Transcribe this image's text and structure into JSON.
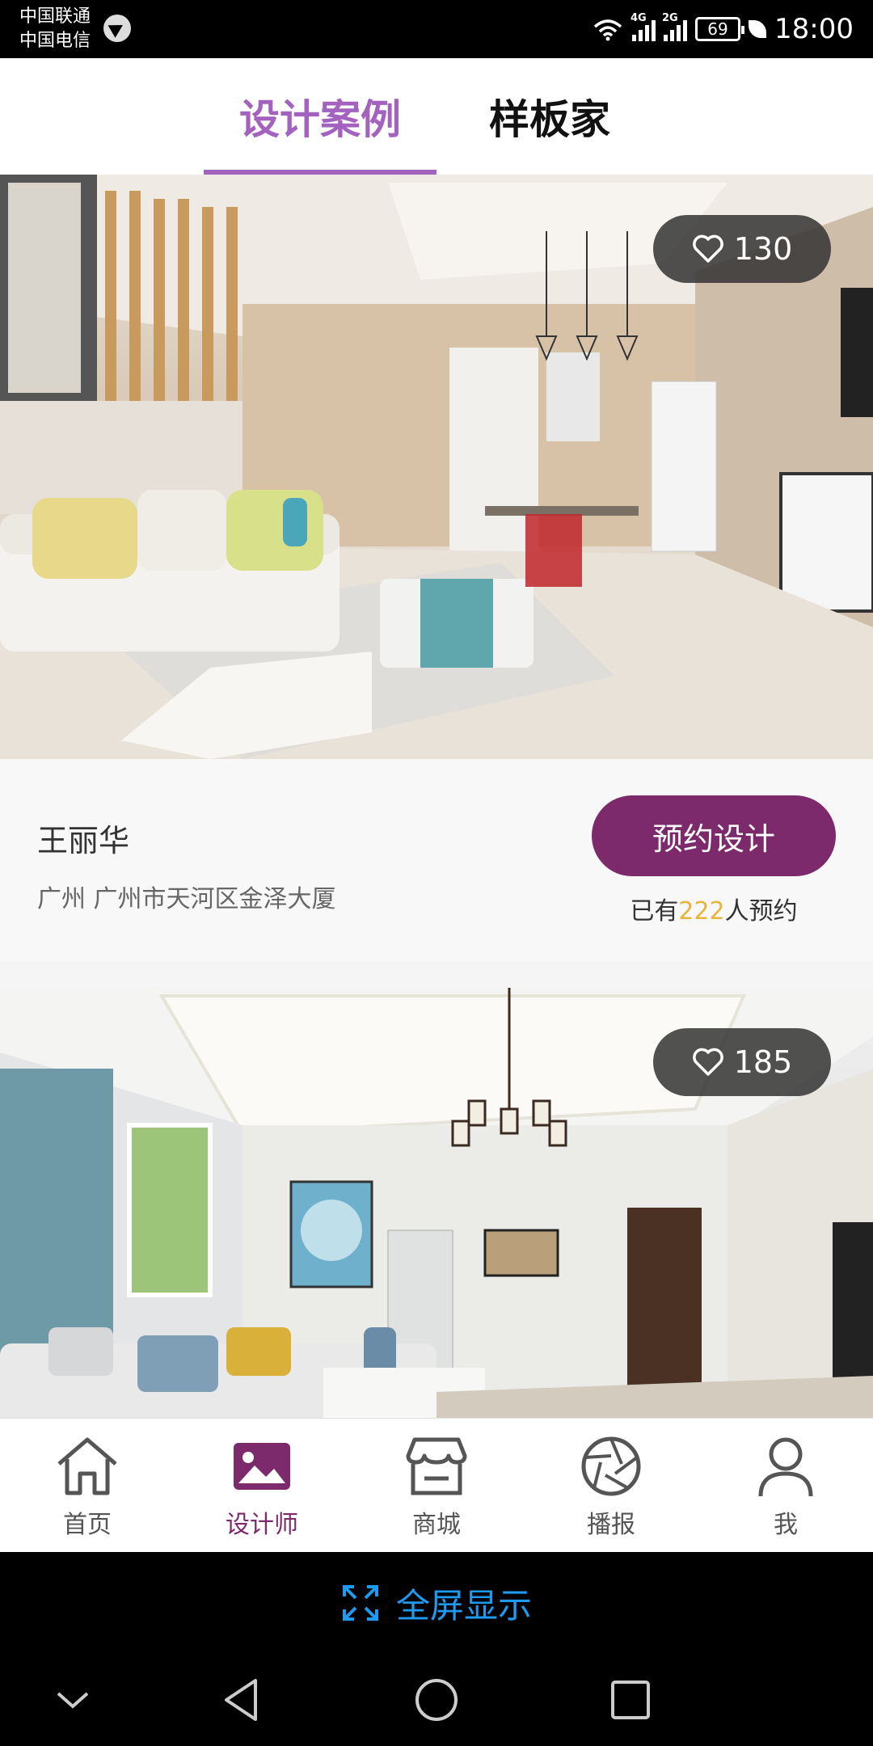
{
  "status_bar": {
    "carrier_1": "中国联通",
    "carrier_2": "中国电信",
    "network_1": "4G",
    "network_2": "2G",
    "battery": "69",
    "time": "18:00"
  },
  "tabs": [
    {
      "label": "设计案例",
      "active": true
    },
    {
      "label": "样板家",
      "active": false
    }
  ],
  "cases": [
    {
      "likes": "130",
      "designer": "王丽华",
      "address": "广州  广州市天河区金泽大厦",
      "book_label": "预约设计",
      "booked_prefix": "已有",
      "booked_count": "222",
      "booked_suffix": "人预约"
    },
    {
      "likes": "185"
    }
  ],
  "bottom_nav": [
    {
      "label": "首页",
      "icon": "home-icon",
      "active": false
    },
    {
      "label": "设计师",
      "icon": "image-icon",
      "active": true
    },
    {
      "label": "商城",
      "icon": "store-icon",
      "active": false
    },
    {
      "label": "播报",
      "icon": "aperture-icon",
      "active": false
    },
    {
      "label": "我",
      "icon": "user-icon",
      "active": false
    }
  ],
  "fullscreen": {
    "label": "全屏显示",
    "icon": "expand-icon"
  },
  "colors": {
    "accent_purple": "#a462bf",
    "button_plum": "#7c2a6c",
    "count_gold": "#e8b43a",
    "fullscreen_blue": "#1e9bf0"
  },
  "system_nav": [
    "chevron-down-icon",
    "back-triangle-icon",
    "home-circle-icon",
    "recents-square-icon"
  ]
}
